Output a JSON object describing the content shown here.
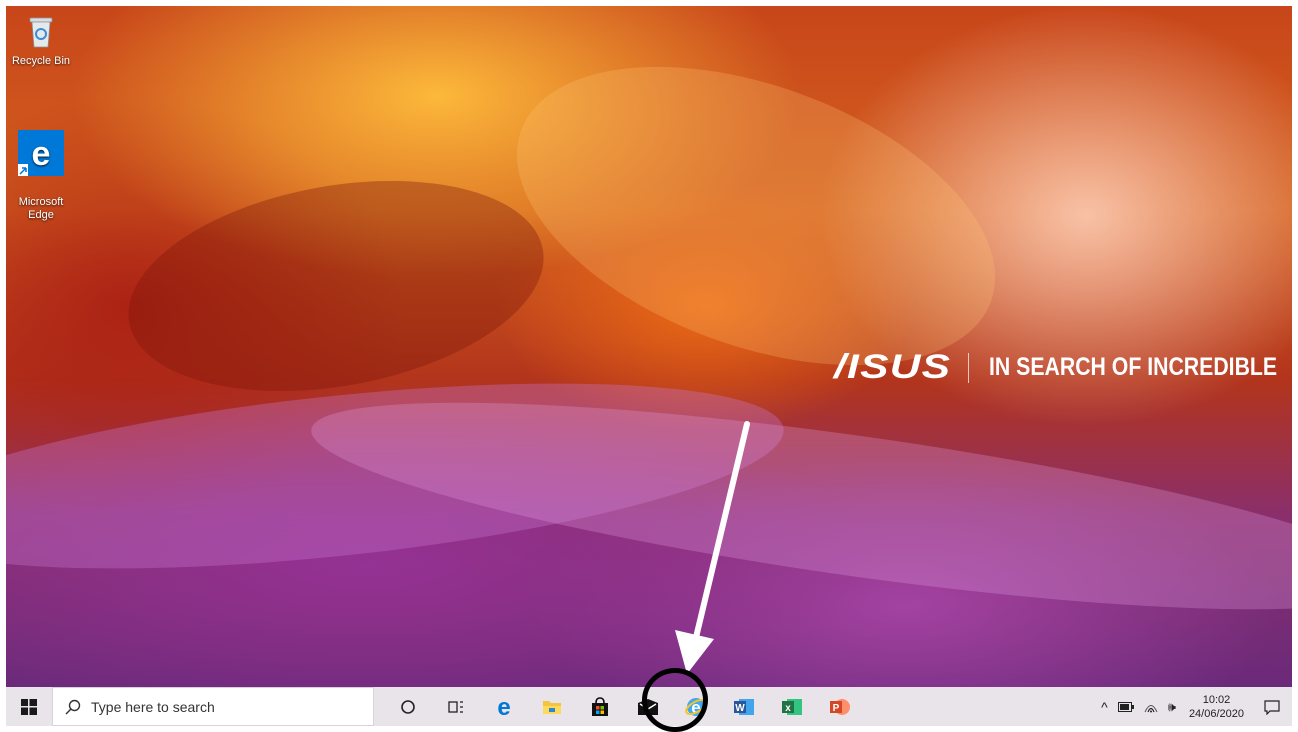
{
  "desktop": {
    "icons": [
      {
        "label": "Recycle Bin",
        "icon": "recycle-bin-icon"
      },
      {
        "label": "Microsoft\nEdge",
        "icon": "edge-icon"
      }
    ],
    "brand": {
      "logo": "/ISUS",
      "tagline": "IN SEARCH OF INCREDIBLE"
    }
  },
  "taskbar": {
    "search": {
      "placeholder": "Type here to search"
    },
    "apps": [
      {
        "name": "cortana",
        "icon": "cortana-circle-icon"
      },
      {
        "name": "task-view",
        "icon": "task-view-icon"
      },
      {
        "name": "edge",
        "icon": "edge-icon"
      },
      {
        "name": "file-explorer",
        "icon": "folder-icon"
      },
      {
        "name": "store",
        "icon": "store-bag-icon"
      },
      {
        "name": "mail",
        "icon": "mail-icon"
      },
      {
        "name": "internet-explorer",
        "icon": "internet-explorer-icon"
      },
      {
        "name": "word",
        "icon": "word-icon",
        "letter": "W"
      },
      {
        "name": "excel",
        "icon": "excel-icon",
        "letter": "x"
      },
      {
        "name": "powerpoint",
        "icon": "powerpoint-icon",
        "letter": "P"
      }
    ],
    "tray": {
      "overflow": "^",
      "volume": "🕪",
      "time": "10:02",
      "date": "24/06/2020"
    }
  },
  "colors": {
    "taskbar_bg": "#e9e3ea",
    "word": "#2b579a",
    "excel": "#217346",
    "powerpoint": "#d24726",
    "edge": "#0078d7"
  }
}
